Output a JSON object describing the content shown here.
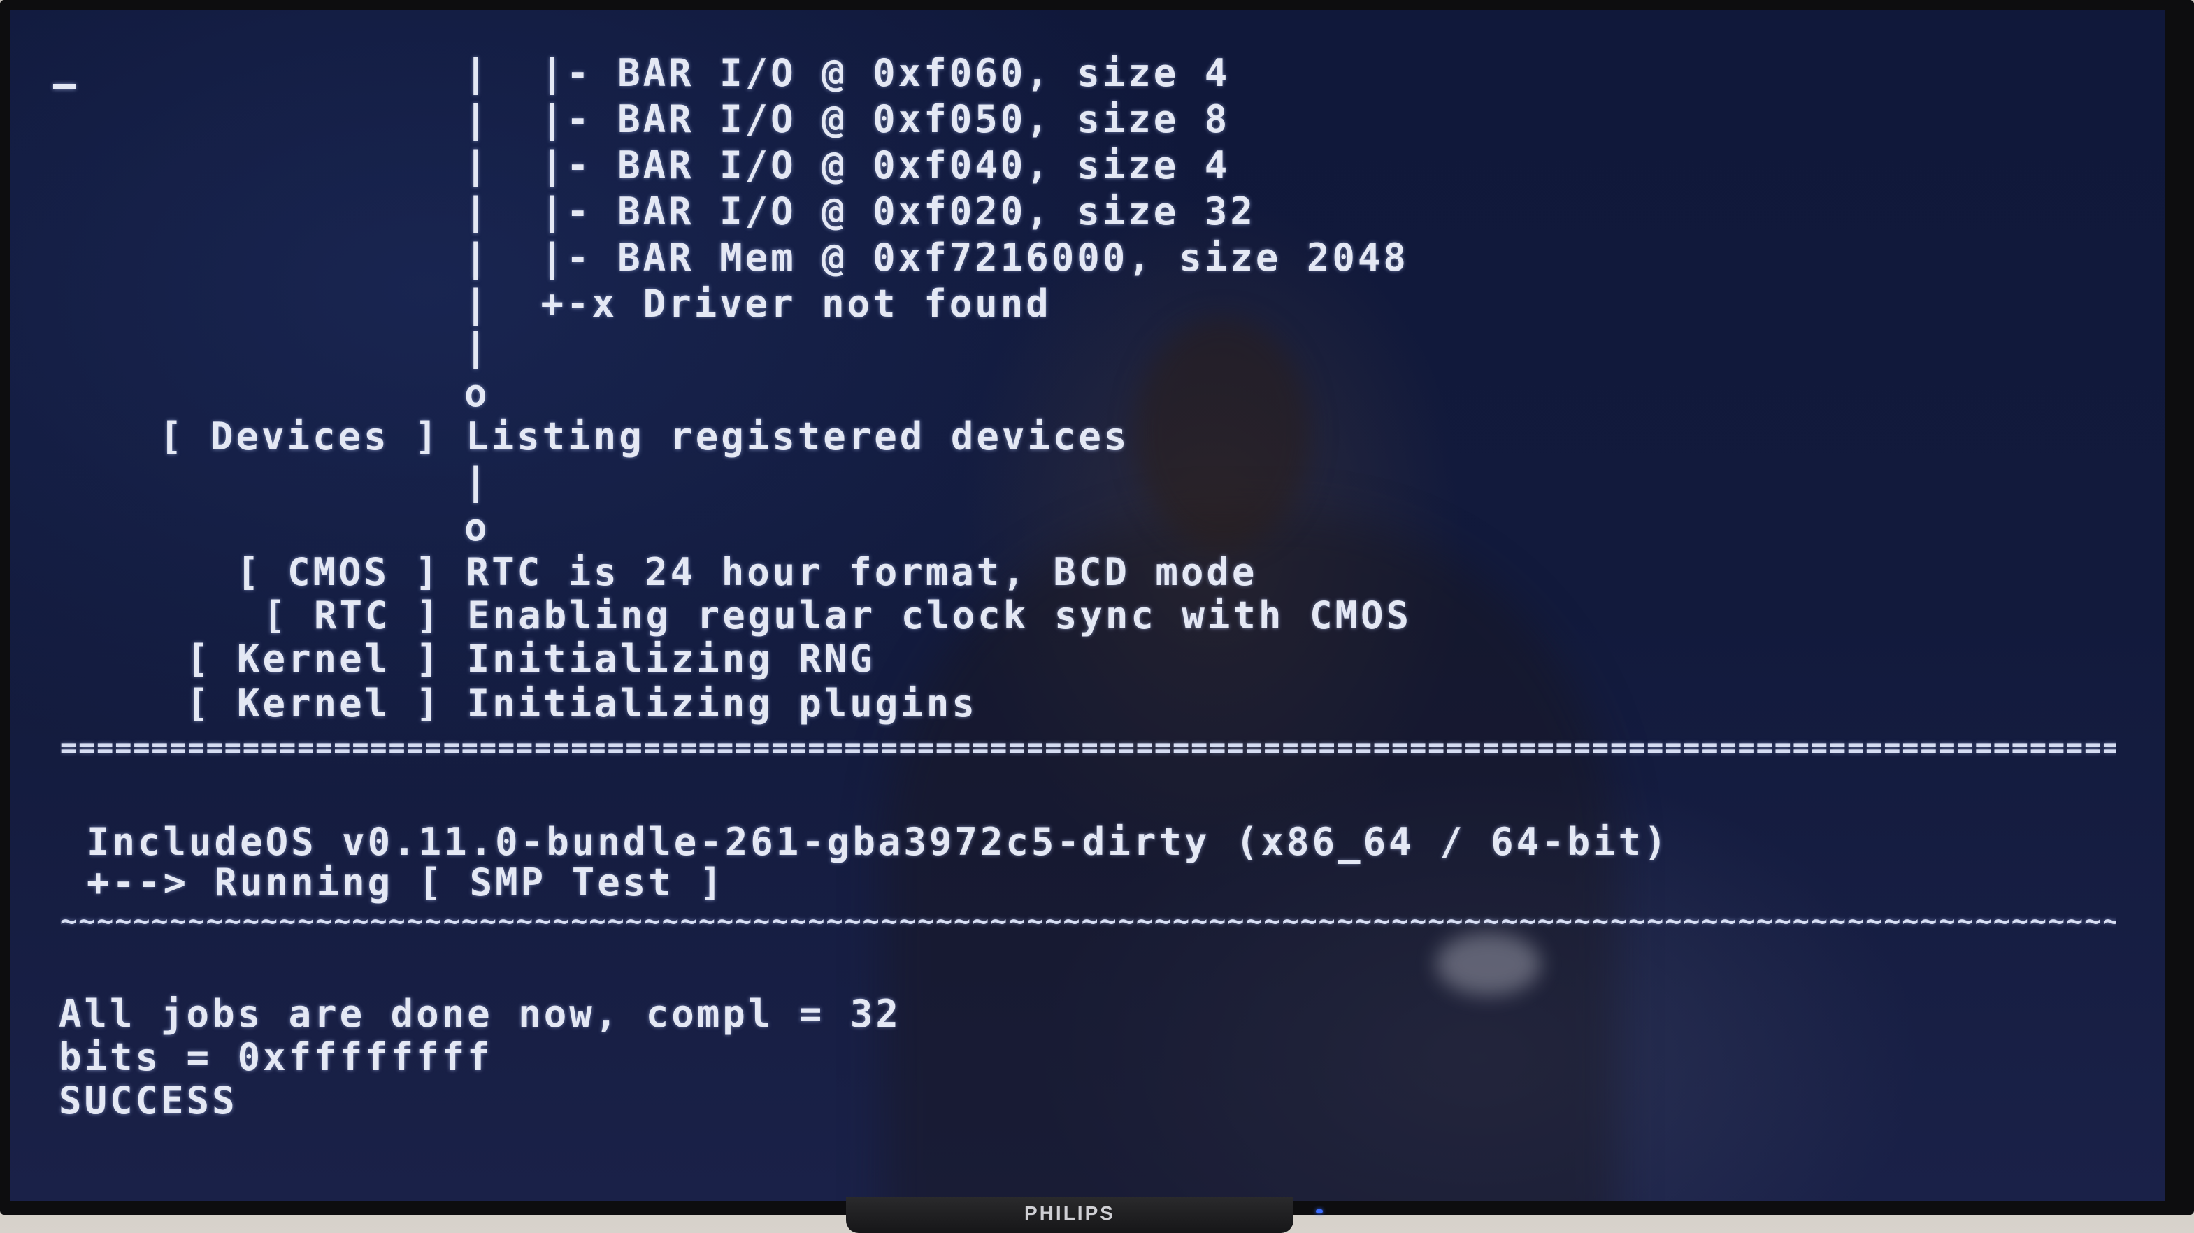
{
  "terminal": {
    "lines": [
      "|  |- BAR I/O @ 0xf060, size 4",
      "|  |- BAR I/O @ 0xf050, size 8",
      "|  |- BAR I/O @ 0xf040, size 4",
      "|  |- BAR I/O @ 0xf020, size 32",
      "|  |- BAR Mem @ 0xf7216000, size 2048",
      "|  +-x Driver not found",
      "|",
      "o",
      "[ Devices ] Listing registered devices",
      "|",
      "o",
      "[ CMOS ] RTC is 24 hour format, BCD mode",
      "[ RTC ] Enabling regular clock sync with CMOS",
      "[ Kernel ] Initializing RNG",
      "[ Kernel ] Initializing plugins",
      "IncludeOS v0.11.0-bundle-261-gba3972c5-dirty (x86_64 / 64-bit)",
      "+--> Running [ SMP Test ]",
      "All jobs are done now, compl = 32",
      "bits = 0xffffffff",
      "SUCCESS"
    ],
    "rule_double": "===================================================================================================================================",
    "rule_tilde": "~~~~~~~~~~~~~~~~~~~~~~~~~~~~~~~~~~~~~~~~~~~~~~~~~~~~~~~~~~~~~~~~~~~~~~~~~~~~~~~~~~~~~~~~~~~~~~~~~~~~~~~~~~~~~~~~~~~~~~~~~~~~~~~~~~~~",
    "colors": {
      "background": "#121a3c",
      "text": "#e4e8f4"
    }
  },
  "tv": {
    "brand": "PHILIPS"
  }
}
